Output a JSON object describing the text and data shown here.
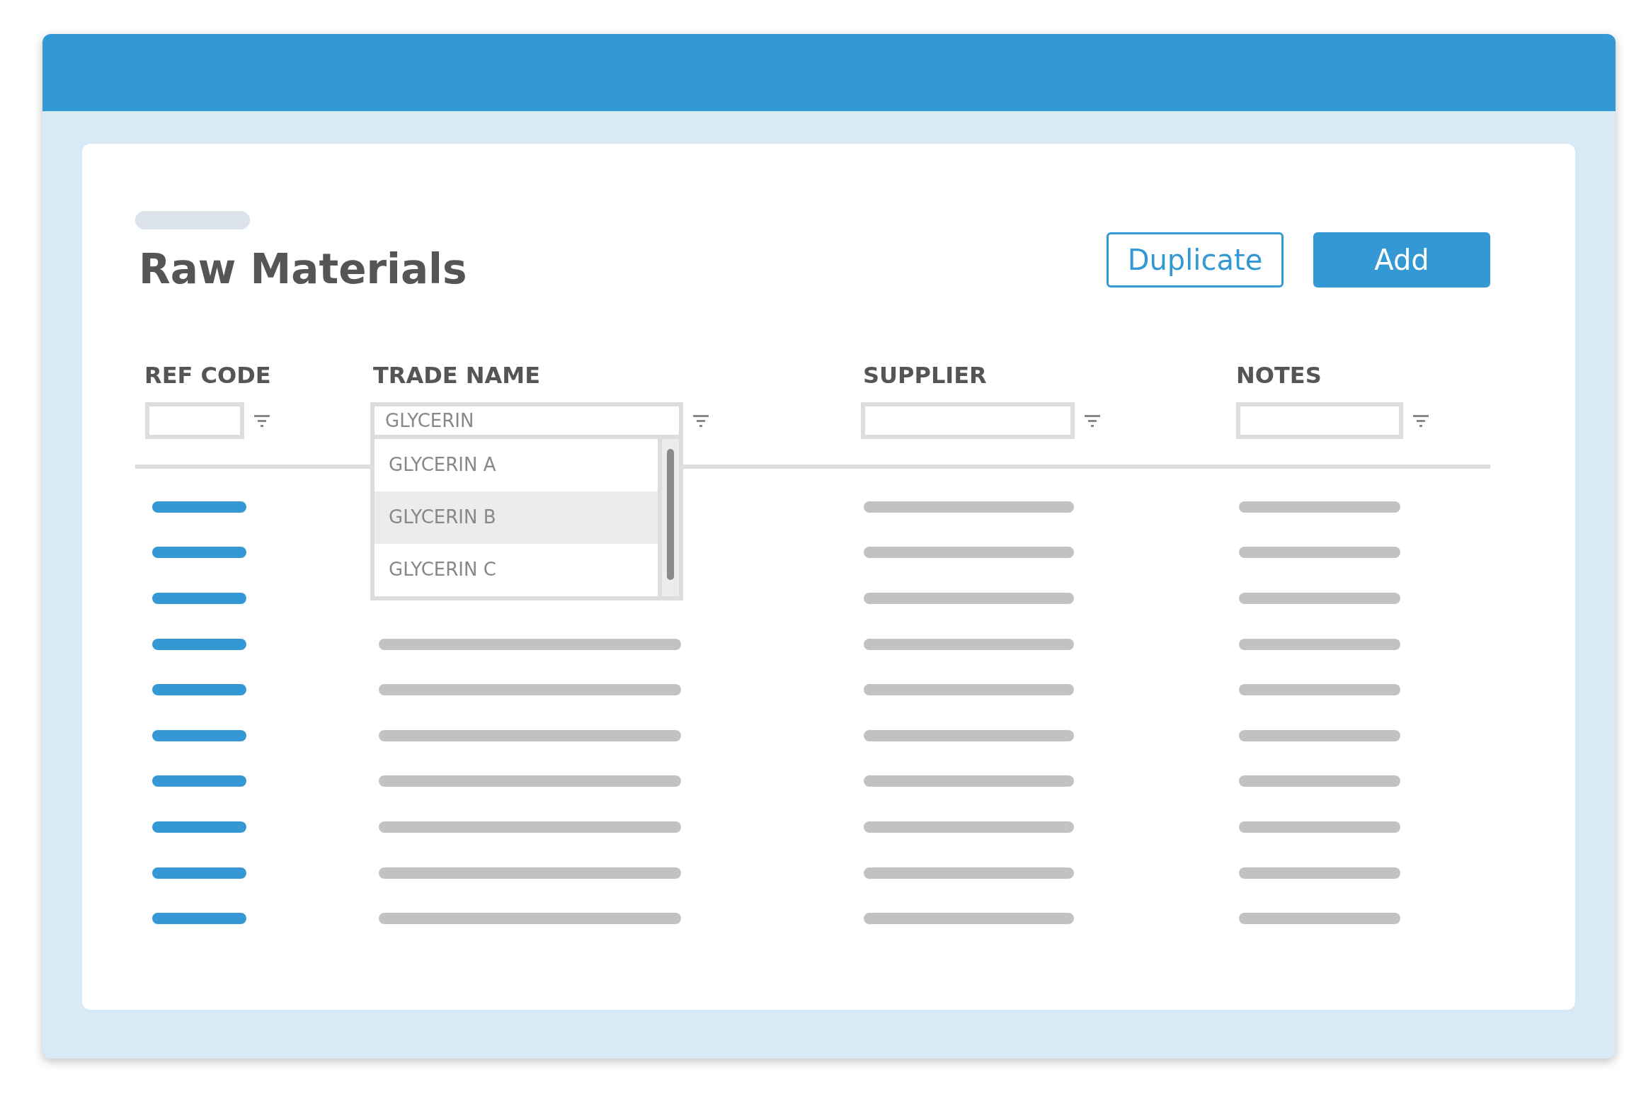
{
  "page": {
    "title": "Raw Materials"
  },
  "buttons": [
    {
      "label": "Duplicate",
      "kind": "outline"
    },
    {
      "label": "Add",
      "kind": "primary"
    }
  ],
  "table": {
    "columns": [
      {
        "label": "REF CODE",
        "kind": "link"
      },
      {
        "label": "TRADE NAME",
        "kind": "text",
        "filter_value": "GLYCERIN",
        "suggestions": [
          {
            "label": "GLYCERIN A",
            "selected": false
          },
          {
            "label": "GLYCERIN B",
            "selected": true
          },
          {
            "label": "GLYCERIN C",
            "selected": false
          }
        ]
      },
      {
        "label": "SUPPLIER",
        "kind": "text"
      },
      {
        "label": "NOTES",
        "kind": "text"
      }
    ]
  }
}
